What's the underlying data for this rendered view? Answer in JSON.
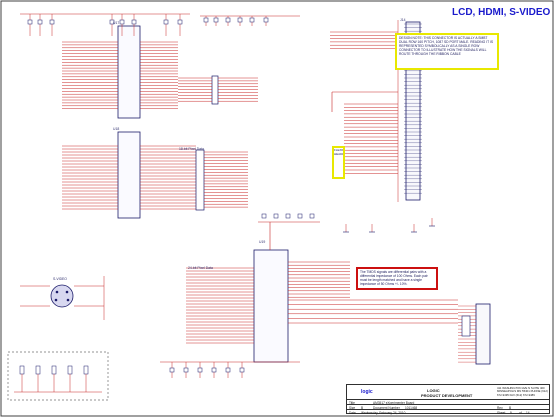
{
  "sheet": {
    "title": "LCD, HDMI, S-VIDEO",
    "design_note": "DESIGN NOTE: THIS CONNECTOR IS ACTUALLY A SMBT DUAL ROW 160 PITCH, 1087 SD PORT MALE. READING IT IS REPRESENTED SYMBOLICALLY AS A SINGLE ROW CONNECTOR TO ILLUSTRATE HOW THE SIGNALS WILL ROUTE THROUGH THE RIBBON CABLE",
    "small_note": "FLEXIBLE HEADER",
    "red_note": "The TMDS signals are differential pairs with a differential impedance of 100 Ohms. Each pair must be length matched and have a single impedance of 50 Ohms +/- 10%.",
    "title_block": {
      "logo": "logic",
      "company_line1": "LOGIC",
      "company_line2": "PRODUCT DEVELOPMENT",
      "address": "411 WASHINGTON AVE N SUITE 400 MINNEAPOLIS MN 55401 PHONE (612) 672-9495 FAX (612) 672-9489",
      "title_label": "Title",
      "title_value": "AM3517 eXperimenter Board",
      "size_label": "Size",
      "size_value": "B",
      "doc_label": "Document Number",
      "doc_value": "1011468",
      "rev_label": "Rev",
      "rev_value": "B",
      "date_label": "Date",
      "date_value": "Wednesday, February 24, 2010",
      "sheet_label": "Sheet",
      "sheet_value": "9",
      "of_label": "of",
      "of_value": "14"
    },
    "labels": {
      "u1_ref": "U17",
      "u2_ref": "U18",
      "u3_ref": "U19",
      "conn_ref": "J14",
      "tmds_bus": "24-bit Pixel Data",
      "mid_bus": "18-bit Pixel Data",
      "lower_bus": "24-bit Pixel Data",
      "svideo": "S-VIDEO",
      "gnd": "DGND",
      "hdmi": "HDMI"
    }
  }
}
